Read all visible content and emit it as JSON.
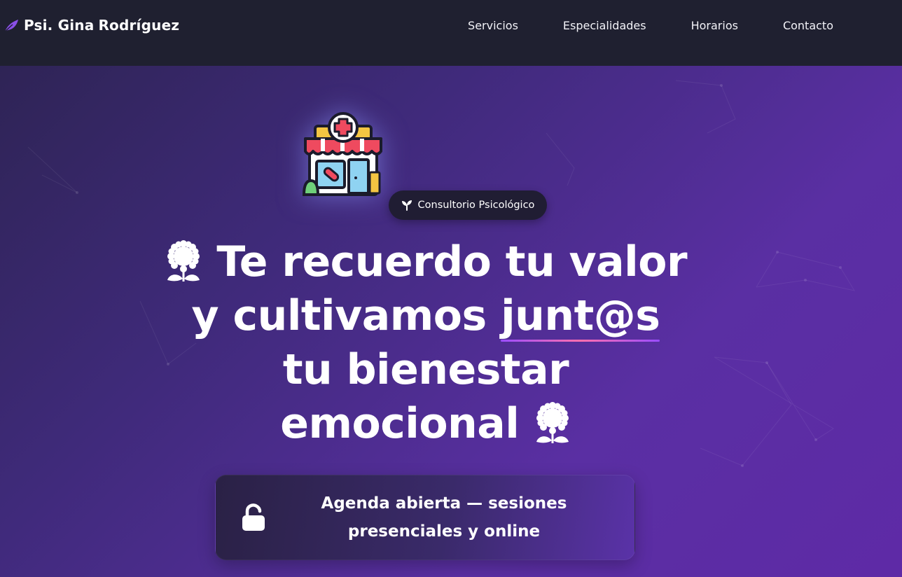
{
  "brand": {
    "first": "Psi. Gina",
    "last": "Rodríguez",
    "icon": "feather-leaf-icon"
  },
  "nav": {
    "items": [
      {
        "label": "Servicios"
      },
      {
        "label": "Especialidades"
      },
      {
        "label": "Horarios"
      },
      {
        "label": "Contacto"
      }
    ]
  },
  "hero": {
    "illustration": "clinic-storefront-icon",
    "badge": {
      "icon": "sprout-icon",
      "label": "Consultorio Psicológico"
    },
    "title": {
      "line1": "Te recuerdo tu valor",
      "line2_prefix": "y cultivamos ",
      "line2_highlight": "junt@s",
      "line3": "tu bienestar",
      "line4": "emocional",
      "flower_icon": "sunflower-icon"
    },
    "agenda": {
      "icon": "unlock-icon",
      "line1": "Agenda abierta — sesiones",
      "line2": "presenciales y online"
    }
  },
  "colors": {
    "navbar": "#1f2030",
    "accent": "#9a4dff",
    "highlight_pink": "#ff6fae"
  }
}
